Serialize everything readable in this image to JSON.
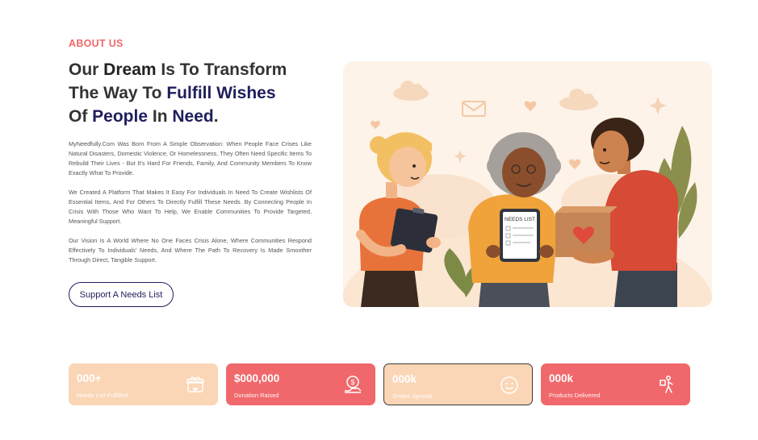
{
  "about": {
    "eyebrow": "ABOUT US",
    "headline": {
      "l1a": "Our ",
      "l1b": "Dream",
      "l1c": " Is To Transform",
      "l2a": "The Way To ",
      "l2b": "Fulfill Wishes",
      "l3a": "Of ",
      "l3b": "People",
      "l3c": " In ",
      "l3d": "Need",
      "l3e": "."
    },
    "paragraphs": [
      "MyNeedfully.Com Was Born From A Simple Observation: When People Face Crises Like Natural Disasters, Domestic Violence, Or Homelessness, They Often Need Specific Items To Rebuild Their Lives - But It's Hard For Friends, Family, And Community Members To Know Exactly What To Provide.",
      "We Created A Platform That Makes It Easy For Individuals In Need To Create Wishlists Of Essential Items, And For Others To Directly Fulfill These Needs. By Connecting People In Crisis With Those Who Want To Help, We Enable Communities To Provide Targeted, Meaningful Support.",
      "Our Vision Is A World Where No One Faces Crisis Alone, Where Communities Respond Effectively To Individuals' Needs, And Where The Path To Recovery Is Made Smoother Through Direct, Tangible Support."
    ],
    "cta_label": "Support A Needs List"
  },
  "illustration": {
    "tablet_text": "NEEDS LIST",
    "icon": "people-sharing-needs-list-illustration"
  },
  "stats": [
    {
      "value": "000+",
      "label": "Needs List Fulfilled",
      "icon": "gift-box-icon"
    },
    {
      "value": "$000,000",
      "label": "Donation Raised",
      "icon": "donation-hand-icon"
    },
    {
      "value": "000k",
      "label": "Smiles Spread",
      "icon": "smile-icon"
    },
    {
      "value": "000k",
      "label": "Products Delivered",
      "icon": "delivery-person-icon"
    }
  ],
  "colors": {
    "accent": "#ec6a6a",
    "navy": "#1f1e5c",
    "peach": "#fad6b6",
    "coral": "#f0686b"
  }
}
